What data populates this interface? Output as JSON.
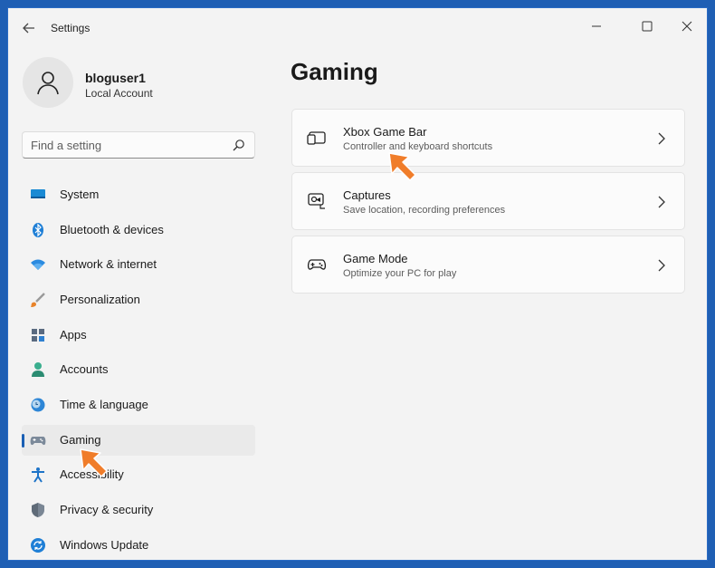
{
  "titlebar": {
    "app_title": "Settings",
    "back_icon": "back-arrow-icon",
    "controls": [
      "minimize-icon",
      "maximize-icon",
      "close-icon"
    ]
  },
  "account": {
    "username": "bloguser1",
    "type": "Local Account"
  },
  "search": {
    "placeholder": "Find a setting",
    "value": ""
  },
  "sidebar": {
    "items": [
      {
        "label": "System",
        "icon": "monitor-icon",
        "active": false
      },
      {
        "label": "Bluetooth & devices",
        "icon": "bluetooth-icon",
        "active": false
      },
      {
        "label": "Network & internet",
        "icon": "wifi-icon",
        "active": false
      },
      {
        "label": "Personalization",
        "icon": "brush-icon",
        "active": false
      },
      {
        "label": "Apps",
        "icon": "apps-icon",
        "active": false
      },
      {
        "label": "Accounts",
        "icon": "person-icon",
        "active": false
      },
      {
        "label": "Time & language",
        "icon": "globe-clock-icon",
        "active": false
      },
      {
        "label": "Gaming",
        "icon": "gamepad-icon",
        "active": true
      },
      {
        "label": "Accessibility",
        "icon": "accessibility-icon",
        "active": false
      },
      {
        "label": "Privacy & security",
        "icon": "shield-icon",
        "active": false
      },
      {
        "label": "Windows Update",
        "icon": "update-icon",
        "active": false
      }
    ]
  },
  "main": {
    "title": "Gaming",
    "cards": [
      {
        "title": "Xbox Game Bar",
        "subtitle": "Controller and keyboard shortcuts",
        "icon": "game-bar-icon"
      },
      {
        "title": "Captures",
        "subtitle": "Save location, recording preferences",
        "icon": "capture-icon"
      },
      {
        "title": "Game Mode",
        "subtitle": "Optimize your PC for play",
        "icon": "controller-icon"
      }
    ]
  },
  "colors": {
    "accent": "#1a5fb4",
    "annotation_arrow": "#f07d2a",
    "background": "#f3f3f3"
  }
}
